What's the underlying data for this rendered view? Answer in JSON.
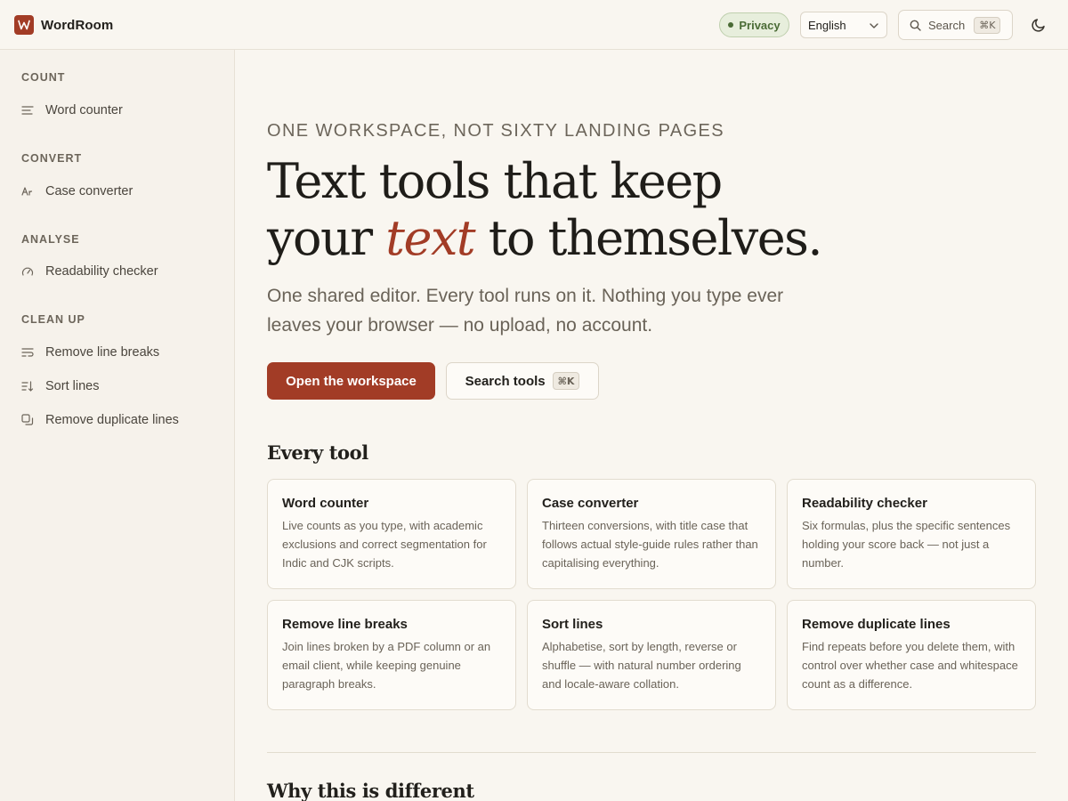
{
  "app": {
    "name": "WordRoom",
    "logo_letter": "W",
    "accent_color": "#a23c26"
  },
  "header": {
    "privacy_label": "Privacy",
    "language": {
      "selected": "English"
    },
    "search": {
      "label": "Search",
      "shortcut": "⌘K"
    },
    "theme_icon": "moon-icon"
  },
  "sidebar": {
    "groups": [
      {
        "title": "COUNT",
        "items": [
          {
            "label": "Word counter",
            "icon": "lines-icon"
          }
        ]
      },
      {
        "title": "CONVERT",
        "items": [
          {
            "label": "Case converter",
            "icon": "case-icon"
          }
        ]
      },
      {
        "title": "ANALYSE",
        "items": [
          {
            "label": "Readability checker",
            "icon": "gauge-icon"
          }
        ]
      },
      {
        "title": "CLEAN UP",
        "items": [
          {
            "label": "Remove line breaks",
            "icon": "wrap-icon"
          },
          {
            "label": "Sort lines",
            "icon": "sort-icon"
          },
          {
            "label": "Remove duplicate lines",
            "icon": "duplicate-icon"
          }
        ]
      }
    ]
  },
  "hero": {
    "kicker": "ONE WORKSPACE, NOT SIXTY LANDING PAGES",
    "headline_line1": "Text tools that keep",
    "headline_pre": "your",
    "headline_em": "text",
    "headline_post": "to themselves.",
    "lede": "One shared editor. Every tool runs on it. Nothing you type ever leaves your browser — no upload, no account.",
    "primary_button": "Open the workspace",
    "secondary_button": "Search tools",
    "secondary_shortcut": "⌘K"
  },
  "tools_section": {
    "title": "Every tool",
    "cards": [
      {
        "title": "Word counter",
        "description": "Live counts as you type, with academic exclusions and correct segmentation for Indic and CJK scripts."
      },
      {
        "title": "Case converter",
        "description": "Thirteen conversions, with title case that follows actual style-guide rules rather than capitalising everything."
      },
      {
        "title": "Readability checker",
        "description": "Six formulas, plus the specific sentences holding your score back — not just a number."
      },
      {
        "title": "Remove line breaks",
        "description": "Join lines broken by a PDF column or an email client, while keeping genuine paragraph breaks."
      },
      {
        "title": "Sort lines",
        "description": "Alphabetise, sort by length, reverse or shuffle — with natural number ordering and locale-aware collation."
      },
      {
        "title": "Remove duplicate lines",
        "description": "Find repeats before you delete them, with control over whether case and whitespace count as a difference."
      }
    ]
  },
  "why_section": {
    "title": "Why this is different"
  }
}
